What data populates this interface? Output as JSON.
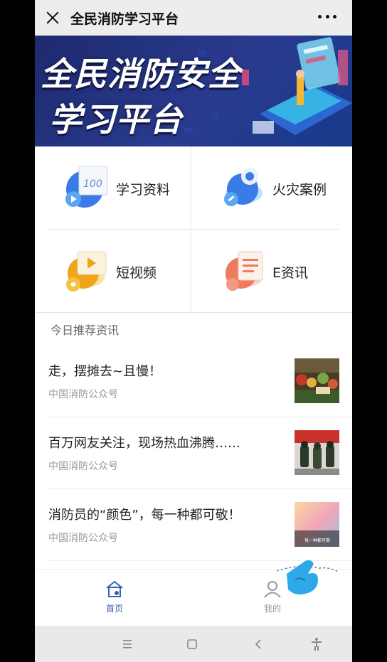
{
  "titlebar": {
    "title": "全民消防学习平台",
    "close_icon": "close-icon",
    "more_icon": "more-dots-icon"
  },
  "banner": {
    "line1": "全民消防安全",
    "line2": "学习平台"
  },
  "menu": [
    {
      "label": "学习资料",
      "icon": "study-materials-icon",
      "color": "#3b7be8"
    },
    {
      "label": "火灾案例",
      "icon": "fire-case-icon",
      "color": "#3b7be8"
    },
    {
      "label": "短视频",
      "icon": "short-video-icon",
      "color": "#f0a418"
    },
    {
      "label": "E资讯",
      "icon": "e-news-icon",
      "color": "#f07a5e"
    }
  ],
  "section": {
    "title": "今日推荐资讯"
  },
  "news": [
    {
      "title": "走，摆摊去~且慢！",
      "source": "中国消防公众号",
      "thumb": "market-stall-thumbnail"
    },
    {
      "title": "百万网友关注，现场热血沸腾……",
      "source": "中国消防公众号",
      "thumb": "firefighters-thumbnail"
    },
    {
      "title": "消防员的“颜色”，每一种都可敬！",
      "source": "中国消防公众号",
      "thumb": "colors-thumbnail"
    }
  ],
  "thumb3_caption": "每一种都可敬",
  "tabbar": {
    "home_label": "首页",
    "mine_label": "我的",
    "active_color": "#3a63b0",
    "inactive_color": "#999999"
  },
  "navbar": {
    "menu_icon": "menu-icon",
    "home_icon": "home-square-icon",
    "back_icon": "back-icon",
    "accessibility_icon": "accessibility-icon"
  }
}
